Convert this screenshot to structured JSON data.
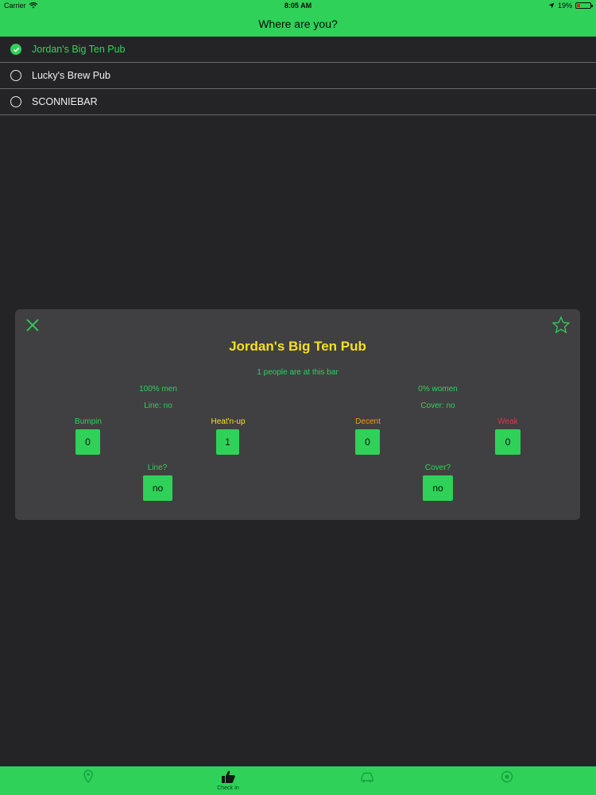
{
  "status_bar": {
    "carrier": "Carrier",
    "time": "8:05 AM",
    "battery": "19%"
  },
  "nav": {
    "title": "Where are you?"
  },
  "bars": [
    {
      "name": "Jordan's Big Ten Pub",
      "selected": true
    },
    {
      "name": "Lucky's Brew Pub",
      "selected": false
    },
    {
      "name": "SCONNIEBAR",
      "selected": false
    }
  ],
  "modal": {
    "title": "Jordan's Big Ten Pub",
    "people_text": "1 people are at this bar",
    "men_text": "100% men",
    "women_text": "0% women",
    "line_status": "Line: no",
    "cover_status": "Cover: no",
    "ratings": [
      {
        "label": "Bumpin",
        "count": "0",
        "color": "#2fd159"
      },
      {
        "label": "Heat'n-up",
        "count": "1",
        "color": "#f4e11d"
      },
      {
        "label": "Decent",
        "count": "0",
        "color": "#f39c12"
      },
      {
        "label": "Weak",
        "count": "0",
        "color": "#e0334a"
      }
    ],
    "line_question": "Line?",
    "line_answer": "no",
    "cover_question": "Cover?",
    "cover_answer": "no"
  },
  "tabs": [
    {
      "label": "",
      "icon": "map-icon"
    },
    {
      "label": "Check In",
      "icon": "thumbs-up-icon"
    },
    {
      "label": "",
      "icon": "car-icon"
    },
    {
      "label": "",
      "icon": "settings-icon"
    }
  ],
  "colors": {
    "accent": "#2fd159",
    "background": "#242426",
    "modal": "#404042",
    "title_yellow": "#f4e11d"
  }
}
